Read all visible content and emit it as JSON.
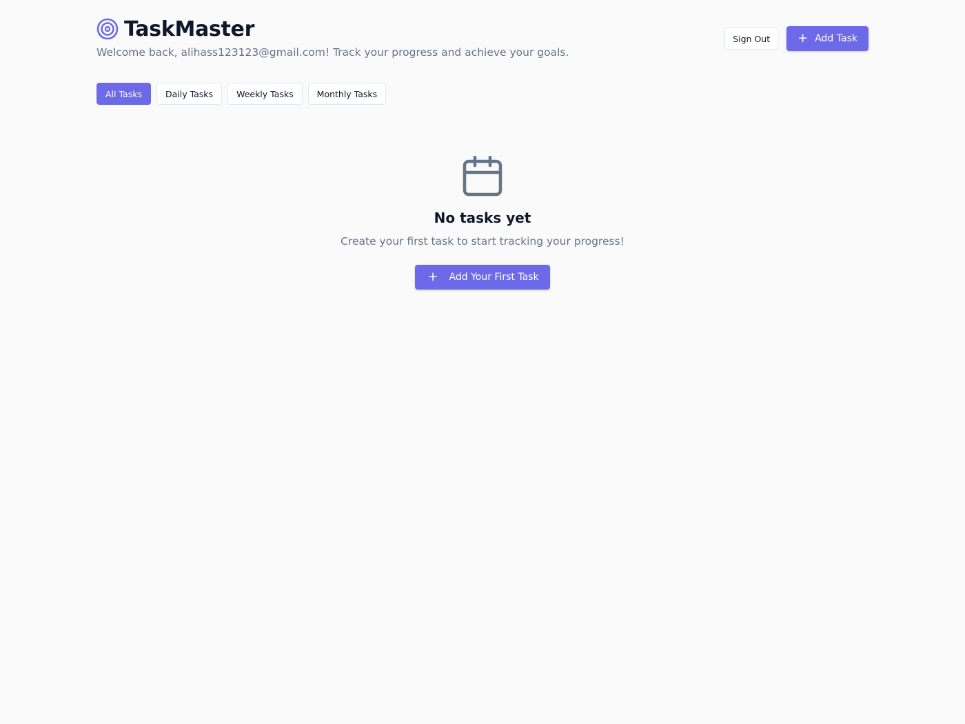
{
  "header": {
    "title": "TaskMaster",
    "welcome": "Welcome back, alihass123123@gmail.com! Track your progress and achieve your goals.",
    "sign_out_label": "Sign Out",
    "add_task_label": "Add Task"
  },
  "tabs": [
    {
      "label": "All Tasks",
      "active": true
    },
    {
      "label": "Daily Tasks",
      "active": false
    },
    {
      "label": "Weekly Tasks",
      "active": false
    },
    {
      "label": "Monthly Tasks",
      "active": false
    }
  ],
  "empty_state": {
    "title": "No tasks yet",
    "subtitle": "Create your first task to start tracking your progress!",
    "cta_label": "Add Your First Task"
  },
  "icons": {
    "brand": "target-icon",
    "empty": "calendar-icon",
    "add": "plus-icon"
  },
  "colors": {
    "accent": "#6c6ae8",
    "text": "#0f172a",
    "muted": "#64748b",
    "background": "#fafafb",
    "icon_gray": "#64748b"
  }
}
